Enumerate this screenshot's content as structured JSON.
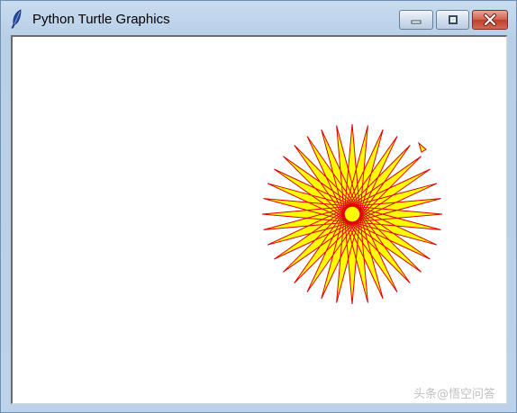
{
  "window": {
    "title": "Python Turtle Graphics",
    "icon": "feather-icon",
    "controls": {
      "minimize": "minimize-icon",
      "maximize": "maximize-icon",
      "close": "close-icon"
    }
  },
  "drawing": {
    "shape": "star",
    "points": 36,
    "pen_color": "#e00000",
    "fill_color": "#ffff00",
    "background": "#ffffff",
    "turtle_cursor": "triangle-cursor"
  },
  "watermark": {
    "text": "头条@悟空问答"
  }
}
